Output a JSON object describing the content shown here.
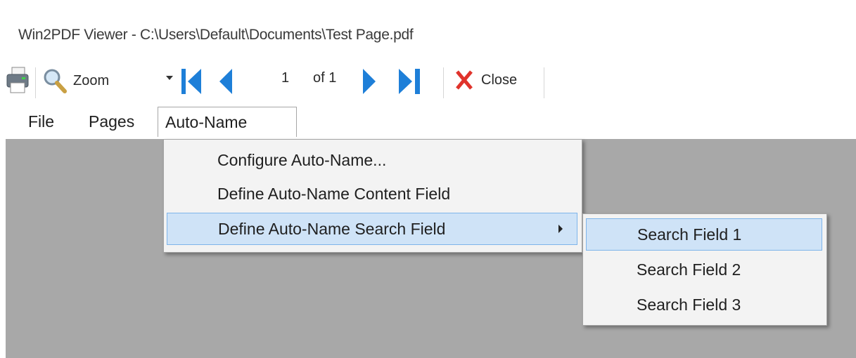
{
  "window": {
    "title": "Win2PDF Viewer - C:\\Users\\Default\\Documents\\Test Page.pdf"
  },
  "toolbar": {
    "print_icon": "printer-icon",
    "zoom_icon": "magnifier-icon",
    "zoom_label": "Zoom",
    "zoom_dropdown_icon": "caret-down-icon",
    "first_page_icon": "first-page-icon",
    "prev_page_icon": "previous-page-icon",
    "page_number": "1",
    "page_total": "of 1",
    "next_page_icon": "next-page-icon",
    "last_page_icon": "last-page-icon",
    "close_icon": "close-x-icon",
    "close_label": "Close",
    "accent_blue": "#1e7fd8",
    "close_red": "#e0332b"
  },
  "menubar": {
    "items": [
      "File",
      "Pages",
      "Auto-Name"
    ],
    "open_item": "Auto-Name"
  },
  "dropdown": {
    "items": [
      "Configure Auto-Name...",
      "Define Auto-Name Content Field",
      "Define Auto-Name Search Field"
    ],
    "highlighted": "Define Auto-Name Search Field"
  },
  "submenu": {
    "items": [
      "Search Field 1",
      "Search Field 2",
      "Search Field 3"
    ],
    "highlighted": "Search Field 1"
  },
  "colors": {
    "content_background": "#a8a8a8",
    "highlight": "#cfe3f7",
    "highlight_border": "#7eb4ea"
  }
}
